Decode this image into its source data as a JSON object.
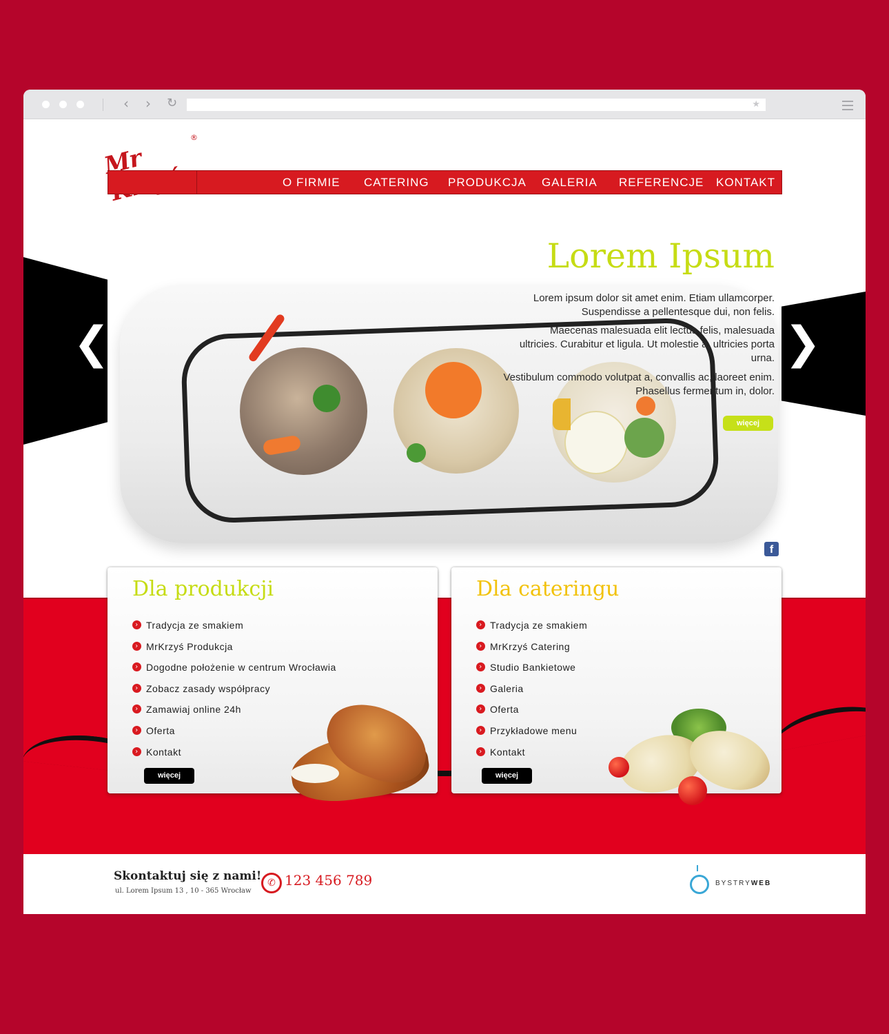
{
  "brand": {
    "logo_text": "Mr Krzyś",
    "registered": "®"
  },
  "nav": [
    {
      "label": "O FIRMIE"
    },
    {
      "label": "CATERING"
    },
    {
      "label": "PRODUKCJA"
    },
    {
      "label": "GALERIA"
    },
    {
      "label": "REFERENCJE"
    },
    {
      "label": "KONTAKT"
    }
  ],
  "hero": {
    "title": "Lorem Ipsum",
    "p1": "Lorem ipsum dolor sit amet enim. Etiam ullamcorper. Suspendisse a pellentesque dui, non felis.",
    "p2": "Maecenas malesuada elit lectus felis, malesuada ultricies. Curabitur et ligula. Ut molestie a, ultricies porta urna.",
    "p3": "Vestibulum commodo volutpat a, convallis ac, laoreet enim. Phasellus fermentum in, dolor.",
    "button": "więcej",
    "prev_icon": "chevron-left-icon",
    "next_icon": "chevron-right-icon"
  },
  "social": {
    "facebook_glyph": "f"
  },
  "cards": [
    {
      "title": "Dla produkcji",
      "items": [
        "Tradycja ze smakiem",
        "MrKrzyś Produkcja",
        "Dogodne położenie w centrum Wrocławia",
        "Zobacz zasady współpracy",
        "Zamawiaj online 24h",
        "Oferta",
        "Kontakt"
      ],
      "button": "więcej"
    },
    {
      "title": "Dla cateringu",
      "items": [
        "Tradycja ze smakiem",
        "MrKrzyś Catering",
        "Studio Bankietowe",
        "Galeria",
        "Oferta",
        "Przykładowe menu",
        "Kontakt"
      ],
      "button": "więcej"
    }
  ],
  "footer": {
    "title": "Skontaktuj się z nami!",
    "address": "ul. Lorem Ipsum 13 ,   10 - 365 Wrocław",
    "phone": "123 456 789",
    "credit_a": "BYSTRY",
    "credit_b": "WEB"
  },
  "colors": {
    "brand_red": "#d71a20",
    "accent_green": "#c6dc14",
    "accent_yellow": "#f2c20a",
    "page_bg": "#b5052b"
  }
}
